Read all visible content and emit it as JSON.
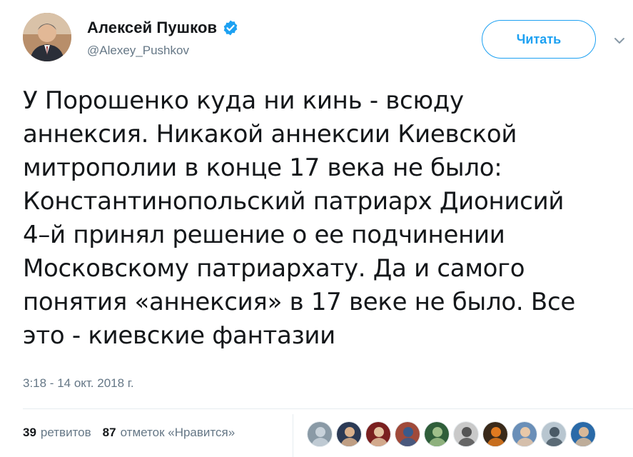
{
  "author": {
    "name": "Алексей Пушков",
    "handle": "@Alexey_Pushkov",
    "verified": true
  },
  "follow_button": {
    "label": "Читать"
  },
  "tweet": {
    "text": "У Порошенко куда ни кинь - всюду\nаннексия. Никакой аннексии Киевской\nмитрополии в конце 17 века не было:\nКонстантинопольский патриарх Дионисий\n4–й принял решение о ее подчинении\nМосковскому патриархату. Да и самого\nпонятия «аннексия» в 17 веке не было. Все\nэто - киевские фантазии",
    "timestamp": "3:18 - 14 окт. 2018 г."
  },
  "stats": {
    "retweets_count": "39",
    "retweets_label": "ретвитов",
    "likes_count": "87",
    "likes_label": "отметок «Нравится»"
  },
  "colors": {
    "accent": "#1da1f2",
    "secondary_text": "#657786",
    "divider": "#e6ecf0"
  },
  "icons": {
    "verified": "verified-badge-icon",
    "caret": "chevron-down-icon"
  },
  "liker_avatars": [
    {
      "name": "liker-avatar-1",
      "bg": "#8a9aa6",
      "fg": "#c8d2da"
    },
    {
      "name": "liker-avatar-2",
      "bg": "#2b3a55",
      "fg": "#d9b08c"
    },
    {
      "name": "liker-avatar-3",
      "bg": "#7a2020",
      "fg": "#e2c2a0"
    },
    {
      "name": "liker-avatar-4",
      "bg": "#a04a3a",
      "fg": "#3a5a8a"
    },
    {
      "name": "liker-avatar-5",
      "bg": "#2f5e3a",
      "fg": "#9fbf8a"
    },
    {
      "name": "liker-avatar-6",
      "bg": "#c9c9c9",
      "fg": "#555555"
    },
    {
      "name": "liker-avatar-7",
      "bg": "#3a2a1a",
      "fg": "#e07a20"
    },
    {
      "name": "liker-avatar-8",
      "bg": "#6a8fb8",
      "fg": "#e8c8a8"
    },
    {
      "name": "liker-avatar-9",
      "bg": "#b8c6d0",
      "fg": "#4a5a66"
    },
    {
      "name": "liker-avatar-10",
      "bg": "#2a6aa8",
      "fg": "#d8b898"
    }
  ]
}
